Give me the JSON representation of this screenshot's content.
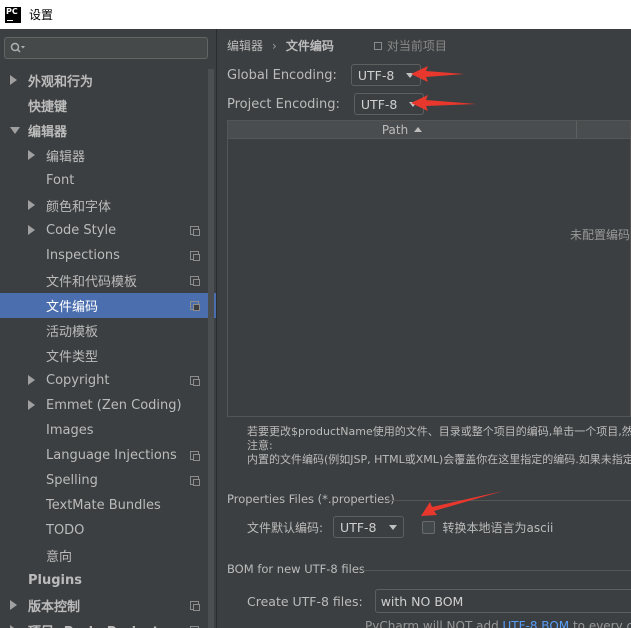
{
  "window": {
    "title": "设置",
    "app_icon": "PC"
  },
  "search": {
    "placeholder": ""
  },
  "sidebar": {
    "items": [
      {
        "label": "外观和行为",
        "level": 0,
        "arrow": "right",
        "bold": true,
        "copy": false,
        "selected": false
      },
      {
        "label": "快捷键",
        "level": 0,
        "arrow": "none",
        "bold": true,
        "copy": false,
        "selected": false
      },
      {
        "label": "编辑器",
        "level": 0,
        "arrow": "down",
        "bold": true,
        "copy": false,
        "selected": false
      },
      {
        "label": "编辑器",
        "level": 1,
        "arrow": "right",
        "bold": false,
        "copy": false,
        "selected": false
      },
      {
        "label": "Font",
        "level": 1,
        "arrow": "none",
        "bold": false,
        "copy": false,
        "selected": false
      },
      {
        "label": "颜色和字体",
        "level": 1,
        "arrow": "right",
        "bold": false,
        "copy": false,
        "selected": false
      },
      {
        "label": "Code Style",
        "level": 1,
        "arrow": "right",
        "bold": false,
        "copy": true,
        "selected": false
      },
      {
        "label": "Inspections",
        "level": 1,
        "arrow": "none",
        "bold": false,
        "copy": true,
        "selected": false
      },
      {
        "label": "文件和代码模板",
        "level": 1,
        "arrow": "none",
        "bold": false,
        "copy": true,
        "selected": false
      },
      {
        "label": "文件编码",
        "level": 1,
        "arrow": "none",
        "bold": false,
        "copy": true,
        "selected": true
      },
      {
        "label": "活动模板",
        "level": 1,
        "arrow": "none",
        "bold": false,
        "copy": false,
        "selected": false
      },
      {
        "label": "文件类型",
        "level": 1,
        "arrow": "none",
        "bold": false,
        "copy": false,
        "selected": false
      },
      {
        "label": "Copyright",
        "level": 1,
        "arrow": "right",
        "bold": false,
        "copy": true,
        "selected": false
      },
      {
        "label": "Emmet (Zen Coding)",
        "level": 1,
        "arrow": "right",
        "bold": false,
        "copy": false,
        "selected": false
      },
      {
        "label": "Images",
        "level": 1,
        "arrow": "none",
        "bold": false,
        "copy": false,
        "selected": false
      },
      {
        "label": "Language Injections",
        "level": 1,
        "arrow": "none",
        "bold": false,
        "copy": true,
        "selected": false
      },
      {
        "label": "Spelling",
        "level": 1,
        "arrow": "none",
        "bold": false,
        "copy": true,
        "selected": false
      },
      {
        "label": "TextMate Bundles",
        "level": 1,
        "arrow": "none",
        "bold": false,
        "copy": false,
        "selected": false
      },
      {
        "label": "TODO",
        "level": 1,
        "arrow": "none",
        "bold": false,
        "copy": false,
        "selected": false
      },
      {
        "label": "意向",
        "level": 1,
        "arrow": "none",
        "bold": false,
        "copy": false,
        "selected": false
      },
      {
        "label": "Plugins",
        "level": 0,
        "arrow": "none",
        "bold": true,
        "copy": false,
        "selected": false
      },
      {
        "label": "版本控制",
        "level": 0,
        "arrow": "right",
        "bold": true,
        "copy": true,
        "selected": false
      },
      {
        "label": "项目: ProbeProject",
        "level": 0,
        "arrow": "right",
        "bold": true,
        "copy": true,
        "selected": false
      }
    ]
  },
  "breadcrumb": {
    "parent": "编辑器",
    "separator": "›",
    "current": "文件编码",
    "project_label": "对当前项目"
  },
  "encoding": {
    "global_label": "Global Encoding:",
    "global_value": "UTF-8",
    "project_label": "Project Encoding:",
    "project_value": "UTF-8"
  },
  "table": {
    "column_path": "Path",
    "empty_text": "未配置编码"
  },
  "help": {
    "line1": "若要更改$productName使用的文件、目录或整个项目的编码,单击一个项目,然后",
    "line2": "注意:",
    "line3": "内置的文件编码(例如JSP, HTML或XML)会覆盖你在这里指定的编码.如果未指定"
  },
  "properties": {
    "section_title": "Properties Files (*.properties)",
    "default_label": "文件默认编码:",
    "default_value": "UTF-8",
    "native_ascii_label": "转换本地语言为ascii",
    "native_ascii_checked": false
  },
  "bom": {
    "section_title": "BOM for new UTF-8 files",
    "create_label": "Create UTF-8 files:",
    "create_value": "with NO BOM",
    "note_prefix": "PyCharm will NOT add ",
    "note_link": "UTF-8 BOM",
    "note_suffix": " to every cr"
  },
  "colors": {
    "background": "#3c3f41",
    "selection": "#4b6eaf",
    "annotation_arrow": "#e8382e",
    "link": "#589df6"
  }
}
